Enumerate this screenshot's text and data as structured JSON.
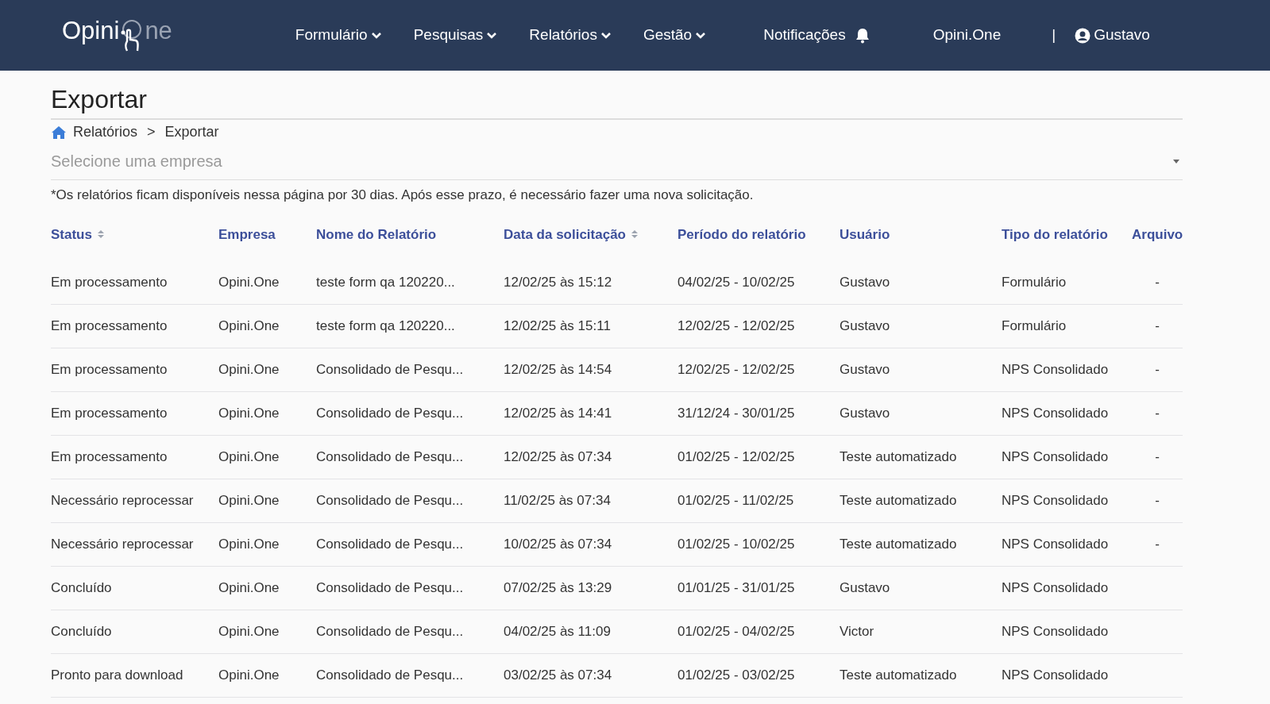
{
  "logo": {
    "text_start": "Opini",
    "text_end": "ne"
  },
  "nav": {
    "menus": [
      {
        "label": "Formulário",
        "kind": "dropdown"
      },
      {
        "label": "Pesquisas",
        "kind": "dropdown"
      },
      {
        "label": "Relatórios",
        "kind": "dropdown"
      },
      {
        "label": "Gestão",
        "kind": "dropdown"
      },
      {
        "label": "Notificações",
        "kind": "notifications"
      },
      {
        "label": "Opini.One",
        "kind": "link"
      }
    ],
    "separator": "|",
    "user": "Gustavo"
  },
  "page": {
    "title": "Exportar",
    "breadcrumb": [
      "Relatórios",
      "Exportar"
    ],
    "breadcrumb_separator": ">"
  },
  "company_select": {
    "placeholder": "Selecione uma empresa"
  },
  "notice": "*Os relatórios ficam disponíveis nessa página por 30 dias. Após esse prazo, é necessário fazer uma nova solicitação.",
  "table": {
    "columns": [
      {
        "label": "Status",
        "sortable": true
      },
      {
        "label": "Empresa",
        "sortable": false
      },
      {
        "label": "Nome do Relatório",
        "sortable": false
      },
      {
        "label": "Data da solicitação",
        "sortable": true
      },
      {
        "label": "Período do relatório",
        "sortable": false
      },
      {
        "label": "Usuário",
        "sortable": false
      },
      {
        "label": "Tipo do relatório",
        "sortable": false
      },
      {
        "label": "Arquivo",
        "sortable": false
      }
    ],
    "rows": [
      {
        "cells": [
          "Em processamento",
          "Opini.One",
          "teste form qa 120220...",
          "12/02/25 às 15:12",
          "04/02/25 - 10/02/25",
          "Gustavo",
          "Formulário",
          "-"
        ]
      },
      {
        "cells": [
          "Em processamento",
          "Opini.One",
          "teste form qa 120220...",
          "12/02/25 às 15:11",
          "12/02/25 - 12/02/25",
          "Gustavo",
          "Formulário",
          "-"
        ]
      },
      {
        "cells": [
          "Em processamento",
          "Opini.One",
          "Consolidado de Pesqu...",
          "12/02/25 às 14:54",
          "12/02/25 - 12/02/25",
          "Gustavo",
          "NPS Consolidado",
          "-"
        ]
      },
      {
        "cells": [
          "Em processamento",
          "Opini.One",
          "Consolidado de Pesqu...",
          "12/02/25 às 14:41",
          "31/12/24 - 30/01/25",
          "Gustavo",
          "NPS Consolidado",
          "-"
        ]
      },
      {
        "cells": [
          "Em processamento",
          "Opini.One",
          "Consolidado de Pesqu...",
          "12/02/25 às 07:34",
          "01/02/25 - 12/02/25",
          "Teste automatizado",
          "NPS Consolidado",
          "-"
        ]
      },
      {
        "cells": [
          "Necessário reprocessar",
          "Opini.One",
          "Consolidado de Pesqu...",
          "11/02/25 às 07:34",
          "01/02/25 - 11/02/25",
          "Teste automatizado",
          "NPS Consolidado",
          "-"
        ]
      },
      {
        "cells": [
          "Necessário reprocessar",
          "Opini.One",
          "Consolidado de Pesqu...",
          "10/02/25 às 07:34",
          "01/02/25 - 10/02/25",
          "Teste automatizado",
          "NPS Consolidado",
          "-"
        ]
      },
      {
        "cells": [
          "Concluído",
          "Opini.One",
          "Consolidado de Pesqu...",
          "07/02/25 às 13:29",
          "01/01/25 - 31/01/25",
          "Gustavo",
          "NPS Consolidado"
        ]
      },
      {
        "cells": [
          "Concluído",
          "Opini.One",
          "Consolidado de Pesqu...",
          "04/02/25 às 11:09",
          "01/02/25 - 04/02/25",
          "Victor",
          "NPS Consolidado"
        ]
      },
      {
        "cells": [
          "Pronto para download",
          "Opini.One",
          "Consolidado de Pesqu...",
          "03/02/25 às 07:34",
          "01/02/25 - 03/02/25",
          "Teste automatizado",
          "NPS Consolidado"
        ]
      }
    ]
  }
}
